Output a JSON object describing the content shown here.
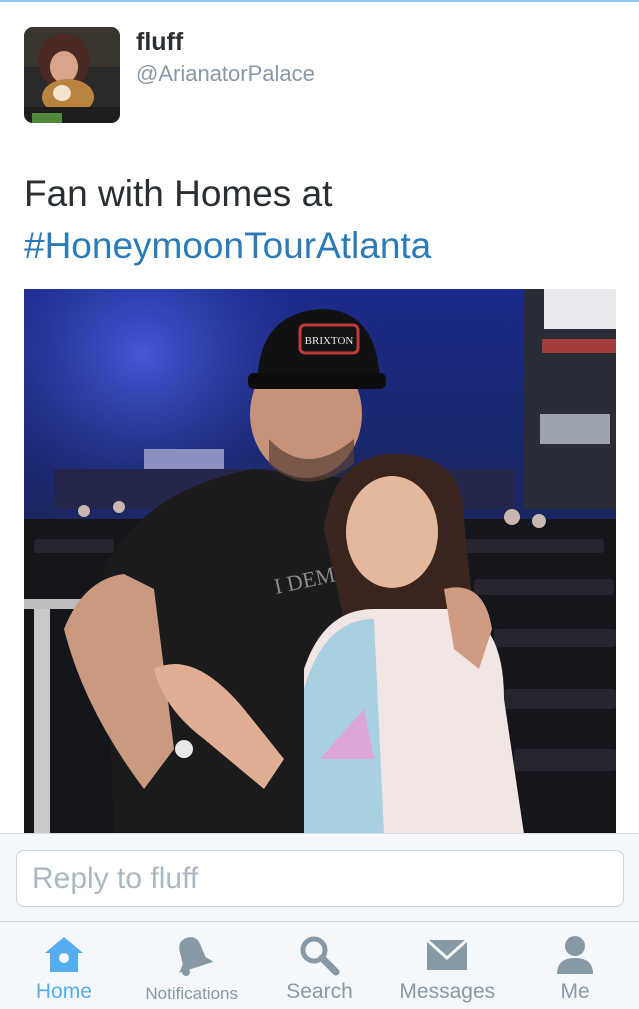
{
  "tweet": {
    "author_name": "fluff",
    "author_handle": "@ArianatorPalace",
    "text": "Fan with Homes at",
    "hashtag": "#HoneymoonTourAtlanta",
    "photo_caps_text": "BRIXTON",
    "photo_shirt_text": "I DEMAND"
  },
  "reply": {
    "placeholder": "Reply to fluff",
    "value": ""
  },
  "tabbar": {
    "items": [
      {
        "label": "Home",
        "icon": "home-icon",
        "active": true
      },
      {
        "label": "Notifications",
        "icon": "bell-icon",
        "active": false
      },
      {
        "label": "Search",
        "icon": "search-icon",
        "active": false
      },
      {
        "label": "Messages",
        "icon": "envelope-icon",
        "active": false
      },
      {
        "label": "Me",
        "icon": "person-icon",
        "active": false
      }
    ]
  },
  "colors": {
    "link": "#2b7bb9",
    "active_tab": "#55acee",
    "inactive_tab": "#8899a6",
    "text": "#292f33"
  }
}
